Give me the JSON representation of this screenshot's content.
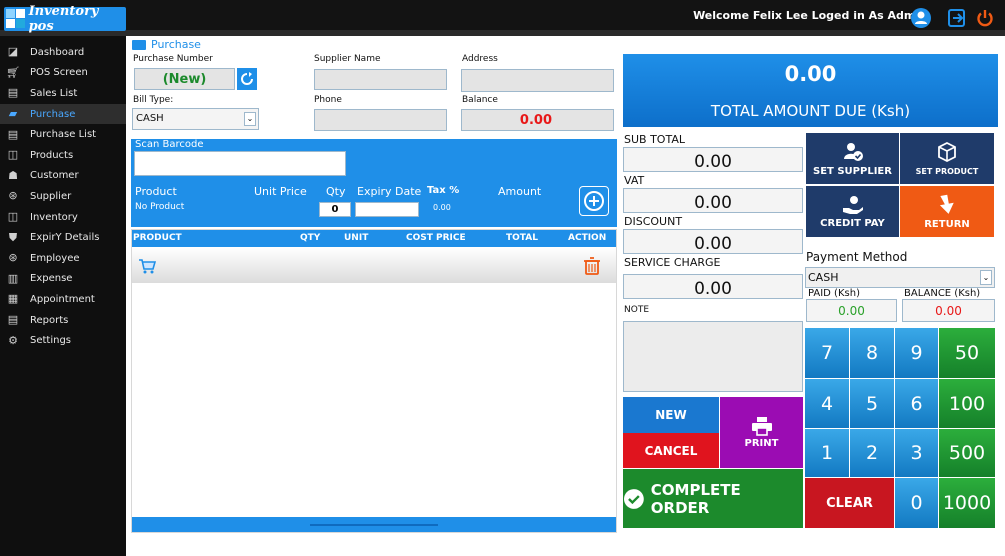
{
  "header": {
    "logo_text": "Inventory pos",
    "welcome": "Welcome Felix Lee Loged in As Admin"
  },
  "sidebar": {
    "items": [
      {
        "label": "Dashboard",
        "icon": "dashboard-icon"
      },
      {
        "label": "POS Screen",
        "icon": "cart-icon"
      },
      {
        "label": "Sales List",
        "icon": "document-icon"
      },
      {
        "label": "Purchase",
        "icon": "truck-icon"
      },
      {
        "label": "Purchase List",
        "icon": "document-icon"
      },
      {
        "label": "Products",
        "icon": "box-icon"
      },
      {
        "label": "Customer",
        "icon": "customer-icon"
      },
      {
        "label": "Supplier",
        "icon": "supplier-icon"
      },
      {
        "label": "Inventory",
        "icon": "box-icon"
      },
      {
        "label": "ExpirY Details",
        "icon": "shield-icon"
      },
      {
        "label": "Employee",
        "icon": "employee-icon"
      },
      {
        "label": "Expense",
        "icon": "money-icon"
      },
      {
        "label": "Appointment",
        "icon": "calendar-icon"
      },
      {
        "label": "Reports",
        "icon": "report-icon"
      },
      {
        "label": "Settings",
        "icon": "gear-icon"
      }
    ]
  },
  "page": {
    "title": "Purchase"
  },
  "form": {
    "purchase_number_label": "Purchase Number",
    "purchase_number_value": "(New)",
    "supplier_name_label": "Supplier Name",
    "supplier_name_value": "",
    "address_label": "Address",
    "address_value": "",
    "bill_type_label": "Bill Type:",
    "bill_type_value": "CASH",
    "phone_label": "Phone",
    "phone_value": "",
    "balance_label": "Balance",
    "balance_value": "0.00"
  },
  "barcode": {
    "label": "Scan Barcode",
    "value": "",
    "headers": {
      "product": "Product",
      "unit_price": "Unit Price",
      "qty": "Qty",
      "expiry": "Expiry Date",
      "tax": "Tax %",
      "amount": "Amount"
    },
    "product_value": "No Product",
    "qty_value": "0",
    "tax_value": "0.00"
  },
  "table": {
    "columns": [
      "PRODUCT",
      "QTY",
      "UNIT",
      "COST PRICE",
      "TOTAL",
      "ACTION"
    ],
    "rows": []
  },
  "totals": {
    "amount_due": "0.00",
    "amount_due_label": "TOTAL AMOUNT DUE (Ksh)",
    "sub_total_label": "SUB TOTAL",
    "sub_total": "0.00",
    "vat_label": "VAT",
    "vat": "0.00",
    "discount_label": "DISCOUNT",
    "discount": "0.00",
    "service_label": "SERVICE CHARGE",
    "service": "0.00",
    "note_label": "NOTE",
    "note": ""
  },
  "actions": {
    "set_supplier": "SET SUPPLIER",
    "set_product": "SET PRODUCT",
    "credit_pay": "CREDIT PAY",
    "return": "RETURN",
    "new": "NEW",
    "cancel": "CANCEL",
    "print": "PRINT",
    "complete": "COMPLETE ORDER"
  },
  "payment": {
    "label": "Payment Method",
    "method": "CASH",
    "paid_label": "PAID (Ksh)",
    "paid": "0.00",
    "balance_label": "BALANCE (Ksh)",
    "balance": "0.00"
  },
  "keypad": {
    "keys": [
      "7",
      "8",
      "9",
      "50",
      "4",
      "5",
      "6",
      "100",
      "1",
      "2",
      "3",
      "500",
      "CLEAR",
      "0",
      "1000"
    ]
  },
  "colors": {
    "accent_blue": "#1f8fe8",
    "navy": "#1f3b6a",
    "orange": "#f05a14",
    "green": "#1c8a2c",
    "red": "#e0141e",
    "purple": "#9b0cb3",
    "balance_red": "#e81818",
    "paid_green": "#2aa12a"
  }
}
